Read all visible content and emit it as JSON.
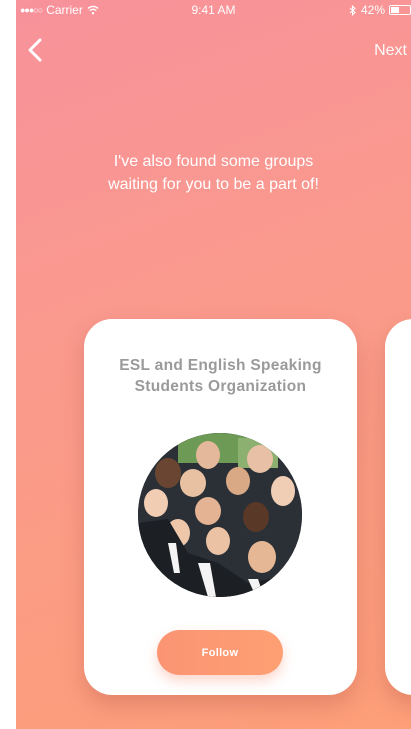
{
  "status_bar": {
    "signal": "●●●○○",
    "carrier": "Carrier",
    "wifi_icon": "wifi-icon",
    "time": "9:41 AM",
    "bluetooth_icon": "bluetooth-icon",
    "battery_text": "42%",
    "battery_level": 0.42
  },
  "nav": {
    "back_icon": "chevron-left-icon",
    "next_label": "Next"
  },
  "headline": {
    "line1": "I've also found some groups",
    "line2": "waiting for you to be a part of!"
  },
  "group_card": {
    "name_line1": "ESL and English Speaking",
    "name_line2": "Students Organization",
    "photo": "group-photo",
    "follow_label": "Follow"
  },
  "colors": {
    "gradient_top": "#f8929b",
    "gradient_bottom": "#fd9f78",
    "button": "#fc9a73",
    "card_title": "#9a9a9a"
  }
}
